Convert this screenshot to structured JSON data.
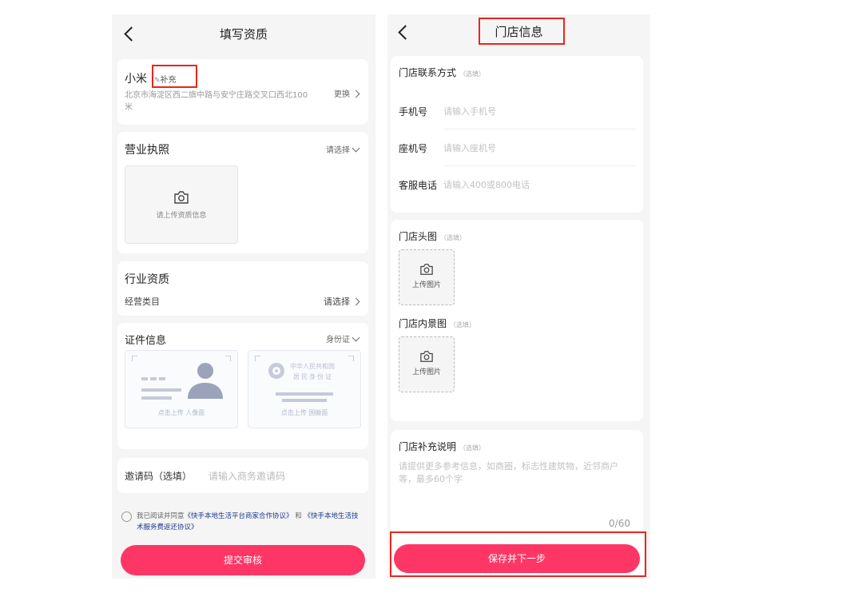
{
  "left": {
    "header_title": "填写资质",
    "shop": {
      "name": "小米",
      "supplement": "补充",
      "address": "北京市海淀区西二旗中路与安宁庄路交叉口西北100米",
      "change": "更换"
    },
    "license": {
      "title": "营业执照",
      "select": "请选择",
      "upload_hint": "请上传资质信息"
    },
    "industry": {
      "title": "行业资质",
      "category_label": "经营类目",
      "select": "请选择"
    },
    "certificate": {
      "title": "证件信息",
      "type": "身份证",
      "portrait_hint": "点击上传 人像面",
      "emblem_hint": "点击上传 国徽面",
      "emblem_card_line1": "中华人民共和国",
      "emblem_card_line2": "居民身份证"
    },
    "invite": {
      "label": "邀请码（选填）",
      "placeholder": "请输入商务邀请码"
    },
    "agreement": {
      "prefix": "我已阅读并同意",
      "doc1": "《快手本地生活平台商家合作协议》",
      "and": "和",
      "doc2": "《快手本地生活技术服务费返还协议》"
    },
    "submit": "提交审核"
  },
  "right": {
    "header_title": "门店信息",
    "contact": {
      "title": "门店联系方式",
      "optional": "（选填）",
      "phone_label": "手机号",
      "phone_placeholder": "请输入手机号",
      "landline_label": "座机号",
      "landline_placeholder": "请输入座机号",
      "service_label": "客服电话",
      "service_placeholder": "请输入400或800电话"
    },
    "avatar": {
      "title": "门店头图",
      "optional": "（选填）",
      "upload": "上传图片"
    },
    "interior": {
      "title": "门店内景图",
      "optional": "（选填）",
      "upload": "上传图片"
    },
    "notes": {
      "title": "门店补充说明",
      "optional": "（选填）",
      "placeholder": "请提供更多参考信息，如商圈，标志性建筑物，近邻商户等，最多60个字",
      "counter": "0/60"
    },
    "save": "保存并下一步"
  },
  "colors": {
    "accent": "#fe3666",
    "highlight": "#e8261c",
    "background": "#f5f5f5"
  },
  "icons": [
    "back-icon",
    "camera-icon",
    "chevron-right-icon",
    "chevron-down-icon",
    "edit-icon",
    "radio-icon"
  ]
}
